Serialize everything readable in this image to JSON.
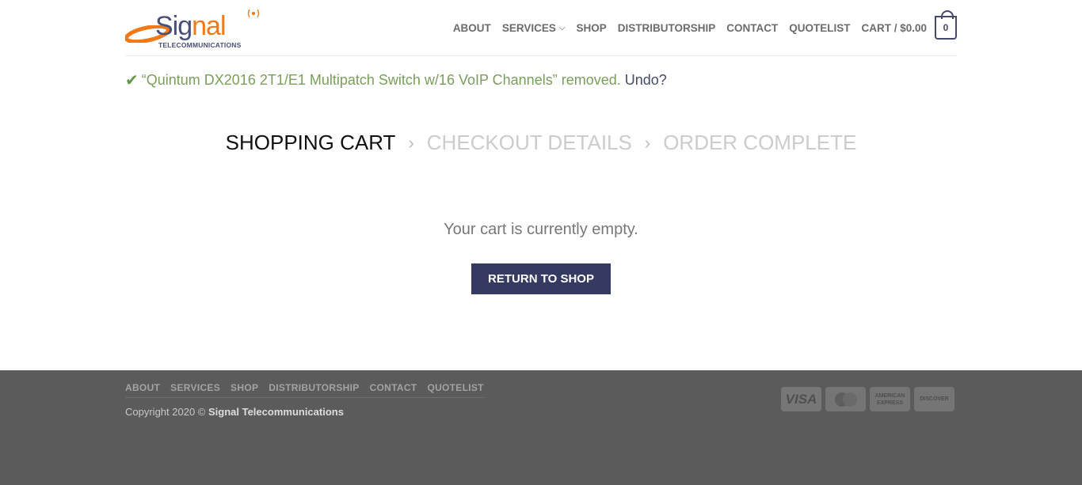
{
  "brand": {
    "name_main": "Sig",
    "name_accent": "nal",
    "tagline": "TELECOMMUNICATIONS",
    "colors": {
      "navy": "#444a6d",
      "orange": "#f07a1a"
    }
  },
  "nav": {
    "items": [
      "ABOUT",
      "SERVICES",
      "SHOP",
      "DISTRIBUTORSHIP",
      "CONTACT",
      "QUOTELIST"
    ],
    "cart_label": "CART / $0.00",
    "cart_count": "0"
  },
  "notice": {
    "check": "✔",
    "text": "“Quintum DX2016 2T1/E1 Multipatch Switch w/16 VoIP Channels” removed.",
    "undo": "Undo?"
  },
  "steps": [
    "SHOPPING CART",
    "CHECKOUT DETAILS",
    "ORDER COMPLETE"
  ],
  "cart": {
    "empty_message": "Your cart is currently empty.",
    "return_button": "RETURN TO SHOP",
    "button_color": "#353a63"
  },
  "footer": {
    "nav": [
      "ABOUT",
      "SERVICES",
      "SHOP",
      "DISTRIBUTORSHIP",
      "CONTACT",
      "QUOTELIST"
    ],
    "copyright_prefix": "Copyright 2020 ©",
    "copyright_company": "Signal Telecommunications",
    "payment_icons": [
      "visa-icon",
      "mastercard-icon",
      "american-express-icon",
      "discover-icon"
    ],
    "payment_labels": {
      "visa": "VISA",
      "mastercard": "MasterCard",
      "amex": "AMERICAN EXPRESS",
      "discover": "DISCOVER"
    },
    "background": "#5b5b5b"
  }
}
